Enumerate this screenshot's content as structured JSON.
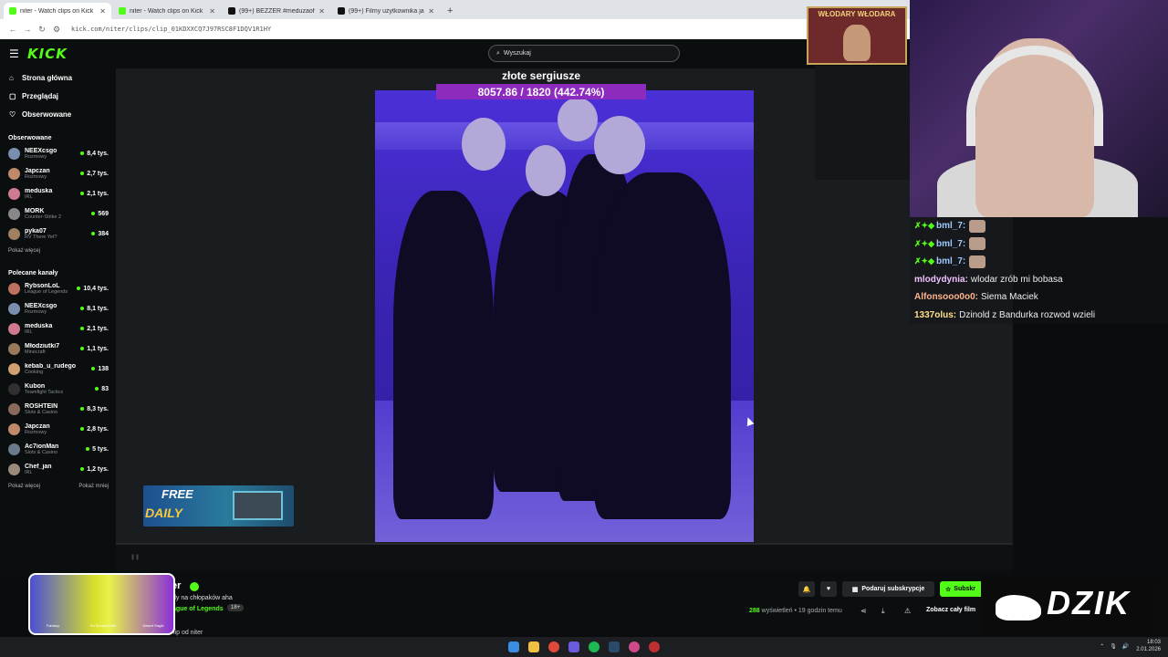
{
  "browser": {
    "tabs": [
      {
        "title": "niter - Watch clips on Kick",
        "active": true,
        "fav": "#53fc18"
      },
      {
        "title": "niter - Watch clips on Kick",
        "active": false,
        "fav": "#53fc18"
      },
      {
        "title": "(99+) BEZZER #meduzaofficial",
        "active": false,
        "fav": "#111111"
      },
      {
        "title": "(99+) Filmy użytkownika jak zw...",
        "active": false,
        "fav": "#111111"
      }
    ],
    "url": "kick.com/niter/clips/clip_01KDXXCQ7J97RSC8F1DQV1R1HY",
    "new_tab": "+"
  },
  "kick": {
    "logo": "KICK",
    "search_placeholder": "Wyszukaj",
    "nav": [
      {
        "label": "Strona główna",
        "icon": "home-icon",
        "glyph": "⌂"
      },
      {
        "label": "Przeglądaj",
        "icon": "browse-icon",
        "glyph": "▢"
      },
      {
        "label": "Obserwowane",
        "icon": "heart-icon",
        "glyph": "♡"
      }
    ],
    "followed_title": "Obserwowane",
    "followed": [
      {
        "name": "NEEXcsgo",
        "cat": "Rozmowy",
        "viewers": "8,4 tys.",
        "color": "#7a8fb0"
      },
      {
        "name": "Japczan",
        "cat": "Rozmowy",
        "viewers": "2,7 tys.",
        "color": "#c08a6a"
      },
      {
        "name": "meduska",
        "cat": "IRL",
        "viewers": "2,1 tys.",
        "color": "#d07a90"
      },
      {
        "name": "MORK",
        "cat": "Counter-Strike 2",
        "viewers": "569",
        "color": "#888888"
      },
      {
        "name": "pyka07",
        "cat": "RV There Yet?",
        "viewers": "384",
        "color": "#a08060"
      }
    ],
    "show_more": "Pokaż więcej",
    "recommended_title": "Polecane kanały",
    "recommended": [
      {
        "name": "RybsonLoL",
        "cat": "League of Legends",
        "viewers": "10,4 tys.",
        "color": "#c07060"
      },
      {
        "name": "NEEXcsgo",
        "cat": "Rozmowy",
        "viewers": "8,1 tys.",
        "color": "#7a8fb0"
      },
      {
        "name": "meduska",
        "cat": "IRL",
        "viewers": "2,1 tys.",
        "color": "#d07a90"
      },
      {
        "name": "Młodziutki7",
        "cat": "Minecraft",
        "viewers": "1,1 tys.",
        "color": "#9a7a5a"
      },
      {
        "name": "kebab_u_rudego",
        "cat": "Cooking",
        "viewers": "138",
        "color": "#d0a070"
      },
      {
        "name": "Kubon",
        "cat": "Teamfight Tactics",
        "viewers": "83",
        "color": "#303030"
      },
      {
        "name": "ROSHTEIN",
        "cat": "Slots & Casino",
        "viewers": "8,3 tys.",
        "color": "#8a6a5a"
      },
      {
        "name": "Japczan",
        "cat": "Rozmowy",
        "viewers": "2,8 tys.",
        "color": "#c08a6a"
      },
      {
        "name": "Ac7ionMan",
        "cat": "Slots & Casino",
        "viewers": "5 tys.",
        "color": "#6a7a8a"
      },
      {
        "name": "Chef_jan",
        "cat": "IRL",
        "viewers": "1,2 tys.",
        "color": "#9a8a7a"
      }
    ],
    "show_less": "Pokaż mniej",
    "goal_title": "złote sergiusze",
    "goal_value": "8057.86 / 1820 (442.74%)",
    "channel": {
      "name": "er",
      "clip_title": "dy na chłopaków aha",
      "category": "ague of Legends",
      "age": "18+",
      "clip_by": "lip od niter"
    },
    "gift_label": "Podaruj subskrypcje",
    "subscribe_label": "Subskr",
    "views_count": "288",
    "views_label": "wyświetleń",
    "time_ago": "• 19 godzin temu",
    "see_full": "Zobacz cały film"
  },
  "overlay": {
    "promo_free": "FREE",
    "promo_daily": "DAILY",
    "banner_text": "WŁODARY WŁODARA",
    "knife_labels": [
      "Fantasy",
      "It's Sunset Knife",
      "Desert Eagle"
    ],
    "dzik": "DZIK"
  },
  "chat": [
    {
      "user": "bml_7:",
      "text": "",
      "color": "#9cc9ff",
      "emote": true
    },
    {
      "user": "bml_7:",
      "text": "",
      "color": "#9cc9ff",
      "emote": true
    },
    {
      "user": "bml_7:",
      "text": "",
      "color": "#9cc9ff",
      "emote": true
    },
    {
      "user": "mlodydynia:",
      "text": "wlodar zrób mi bobasa",
      "color": "#f0c0ff",
      "emote": false
    },
    {
      "user": "Alfonsooo0o0:",
      "text": "Siema Maciek",
      "color": "#ffb48c",
      "emote": false
    },
    {
      "user": "1337olus:",
      "text": "Dzinold z Bandurka rozwod wzieli",
      "color": "#ffe08a",
      "emote": false
    }
  ],
  "taskbar": {
    "time": "18:03",
    "date": "2.01.2026"
  }
}
